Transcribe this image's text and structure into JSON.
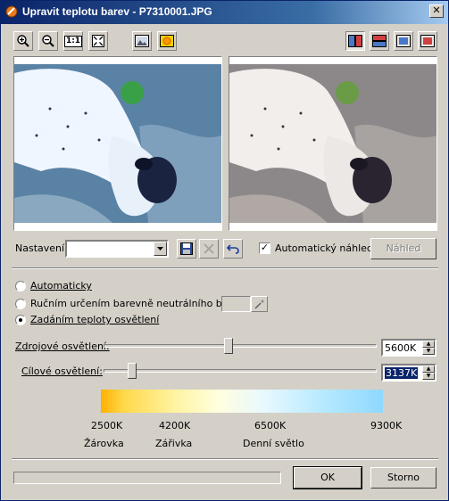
{
  "window": {
    "title": "Upravit teplotu barev - P7310001.JPG",
    "close_glyph": "✕"
  },
  "toolbar": {
    "left_icons": [
      "zoom-in-icon",
      "zoom-out-icon",
      "actual-size-icon",
      "fit-to-window-icon",
      "show-original-icon",
      "show-result-icon"
    ],
    "actual_size_label": "1:1",
    "right_icons": [
      "split-vertical-icon",
      "split-horizontal-icon",
      "single-view-original-icon",
      "single-view-result-icon"
    ]
  },
  "preset": {
    "label": "Nastavení:",
    "value": "",
    "icons": [
      "save-icon",
      "delete-icon",
      "undo-icon"
    ]
  },
  "auto_preview": {
    "label": "Automatický náhled",
    "checked": true
  },
  "preview_button": "Náhled",
  "modes": [
    {
      "label": "Automaticky",
      "selected": false
    },
    {
      "label": "Ručním určením barevně neutrálního bodu",
      "selected": false
    },
    {
      "label": "Zadáním teploty osvětlení",
      "selected": true
    }
  ],
  "source_light": {
    "label": "Zdrojové osvětlení:",
    "value": "5600K",
    "slider_fraction": 0.46
  },
  "target_light": {
    "label": "Cílové osvětlení:",
    "value": "3137K",
    "slider_fraction": 0.105
  },
  "scale": {
    "ticks": [
      "2500K",
      "4200K",
      "6500K",
      "9300K"
    ],
    "names": [
      "Žárovka",
      "Zářivka",
      "Denní světlo"
    ]
  },
  "buttons": {
    "ok": "OK",
    "cancel": "Storno"
  },
  "colors": {
    "title_bar": "#0a246a",
    "selection": "#0a246a",
    "dialog": "#d4d0c8"
  }
}
